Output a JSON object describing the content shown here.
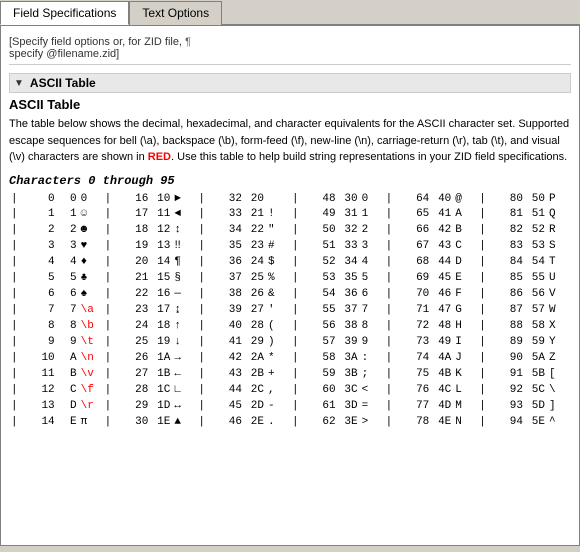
{
  "tabs": [
    {
      "id": "field-specs",
      "label": "Field Specifications",
      "active": true
    },
    {
      "id": "text-options",
      "label": "Text Options",
      "active": false
    }
  ],
  "field_spec_note": "[Specify field options or, for ZID file,",
  "field_spec_note2": "specify @filename.zid]",
  "ascii_section": {
    "header": "ASCII Table",
    "title": "ASCII Table",
    "description1": "The table below shows the decimal, hexadecimal, and character equivalents for the ASCII character set.  Supported escape sequences for bell (\\a), backspace (\\b), form-feed (\\f), new-line (\\n), carriage-return (\\r), tab (\\t), and visual (\\v) characters are shown in ",
    "red_word": "RED",
    "description2": ".  Use this table to help build string representations in your ZID field specifications.",
    "chars_heading": "Characters 0 through 95",
    "rows": [
      {
        "d1": "0",
        "h1": "0",
        "c1": "0",
        "d2": "16",
        "h2": "10",
        "c2": "►",
        "d3": "32",
        "h3": "20",
        "c3": " ",
        "d4": "48",
        "h4": "30",
        "c4": "0",
        "d5": "64",
        "h5": "40",
        "c5": "@",
        "d6": "80",
        "h6": "50",
        "c6": "P"
      },
      {
        "d1": "1",
        "h1": "1",
        "c1": "☺",
        "d2": "17",
        "h2": "11",
        "c2": "◄",
        "d3": "33",
        "h3": "21",
        "c3": "!",
        "d4": "49",
        "h4": "31",
        "c4": "1",
        "d5": "65",
        "h5": "41",
        "c5": "A",
        "d6": "81",
        "h6": "51",
        "c6": "Q"
      },
      {
        "d1": "2",
        "h1": "2",
        "c1": "☻",
        "d2": "18",
        "h2": "12",
        "c2": "↕",
        "d3": "34",
        "h3": "22",
        "c3": "\"",
        "d4": "50",
        "h4": "32",
        "c4": "2",
        "d5": "66",
        "h5": "42",
        "c5": "B",
        "d6": "82",
        "h6": "52",
        "c6": "R"
      },
      {
        "d1": "3",
        "h1": "3",
        "c1": "♥",
        "d2": "19",
        "h2": "13",
        "c2": "‼",
        "d3": "35",
        "h3": "23",
        "c3": "#",
        "d4": "51",
        "h4": "33",
        "c4": "3",
        "d5": "67",
        "h5": "43",
        "c5": "C",
        "d6": "83",
        "h6": "53",
        "c6": "S"
      },
      {
        "d1": "4",
        "h1": "4",
        "c1": "♦",
        "d2": "20",
        "h2": "14",
        "c2": "¶",
        "d3": "36",
        "h3": "24",
        "c3": "$",
        "d4": "52",
        "h4": "34",
        "c4": "4",
        "d5": "68",
        "h5": "44",
        "c5": "D",
        "d6": "84",
        "h6": "54",
        "c6": "T"
      },
      {
        "d1": "5",
        "h1": "5",
        "c1": "♣",
        "d2": "21",
        "h2": "15",
        "c2": "§",
        "d3": "37",
        "h3": "25",
        "c3": "%",
        "d4": "53",
        "h4": "35",
        "c4": "5",
        "d5": "69",
        "h5": "45",
        "c5": "E",
        "d6": "85",
        "h6": "55",
        "c6": "U"
      },
      {
        "d1": "6",
        "h1": "6",
        "c1": "♠",
        "d2": "22",
        "h2": "16",
        "c2": "—",
        "d3": "38",
        "h3": "26",
        "c3": "&",
        "d4": "54",
        "h4": "36",
        "c4": "6",
        "d5": "70",
        "h5": "46",
        "c5": "F",
        "d6": "86",
        "h6": "56",
        "c6": "V"
      },
      {
        "d1": "7",
        "h1": "7",
        "c1": "\\a",
        "c1_red": true,
        "d2": "23",
        "h2": "17",
        "c2": "↨",
        "d3": "39",
        "h3": "27",
        "c3": "'",
        "d4": "55",
        "h4": "37",
        "c4": "7",
        "d5": "71",
        "h5": "47",
        "c5": "G",
        "d6": "87",
        "h6": "57",
        "c6": "W"
      },
      {
        "d1": "8",
        "h1": "8",
        "c1": "\\b",
        "c1_red": true,
        "d2": "24",
        "h2": "18",
        "c2": "↑",
        "d3": "40",
        "h3": "28",
        "c3": "(",
        "d4": "56",
        "h4": "38",
        "c4": "8",
        "d5": "72",
        "h5": "48",
        "c5": "H",
        "d6": "88",
        "h6": "58",
        "c6": "X"
      },
      {
        "d1": "9",
        "h1": "9",
        "c1": "\\t",
        "c1_red": true,
        "d2": "25",
        "h2": "19",
        "c2": "↓",
        "d3": "41",
        "h3": "29",
        "c3": ")",
        "d4": "57",
        "h4": "39",
        "c4": "9",
        "d5": "73",
        "h5": "49",
        "c5": "I",
        "d6": "89",
        "h6": "59",
        "c6": "Y"
      },
      {
        "d1": "10",
        "h1": "A",
        "c1": "\\n",
        "c1_red": true,
        "d2": "26",
        "h2": "1A",
        "c2": "→",
        "d3": "42",
        "h3": "2A",
        "c3": "*",
        "d4": "58",
        "h4": "3A",
        "c4": ":",
        "d5": "74",
        "h5": "4A",
        "c5": "J",
        "d6": "90",
        "h6": "5A",
        "c6": "Z"
      },
      {
        "d1": "11",
        "h1": "B",
        "c1": "\\v",
        "c1_red": true,
        "d2": "27",
        "h2": "1B",
        "c2": "←",
        "d3": "43",
        "h3": "2B",
        "c3": "+",
        "d4": "59",
        "h4": "3B",
        "c4": ";",
        "d5": "75",
        "h5": "4B",
        "c5": "K",
        "d6": "91",
        "h6": "5B",
        "c6": "["
      },
      {
        "d1": "12",
        "h1": "C",
        "c1": "\\f",
        "c1_red": true,
        "d2": "28",
        "h2": "1C",
        "c2": "∟",
        "d3": "44",
        "h3": "2C",
        "c3": ",",
        "d4": "60",
        "h4": "3C",
        "c4": "<",
        "d5": "76",
        "h5": "4C",
        "c5": "L",
        "d6": "92",
        "h6": "5C",
        "c6": "\\"
      },
      {
        "d1": "13",
        "h1": "D",
        "c1": "\\r",
        "c1_red": true,
        "d2": "29",
        "h2": "1D",
        "c2": "↔",
        "d3": "45",
        "h3": "2D",
        "c3": "-",
        "d4": "61",
        "h4": "3D",
        "c4": "=",
        "d5": "77",
        "h5": "4D",
        "c5": "M",
        "d6": "93",
        "h6": "5D",
        "c6": "]"
      },
      {
        "d1": "14",
        "h1": "E",
        "c1": "π",
        "d2": "30",
        "h2": "1E",
        "c2": "▲",
        "d3": "46",
        "h3": "2E",
        "c3": ".",
        "d4": "62",
        "h4": "3E",
        "c4": ">",
        "d5": "78",
        "h5": "4E",
        "c5": "N",
        "d6": "94",
        "h6": "5E",
        "c6": "^"
      }
    ]
  }
}
